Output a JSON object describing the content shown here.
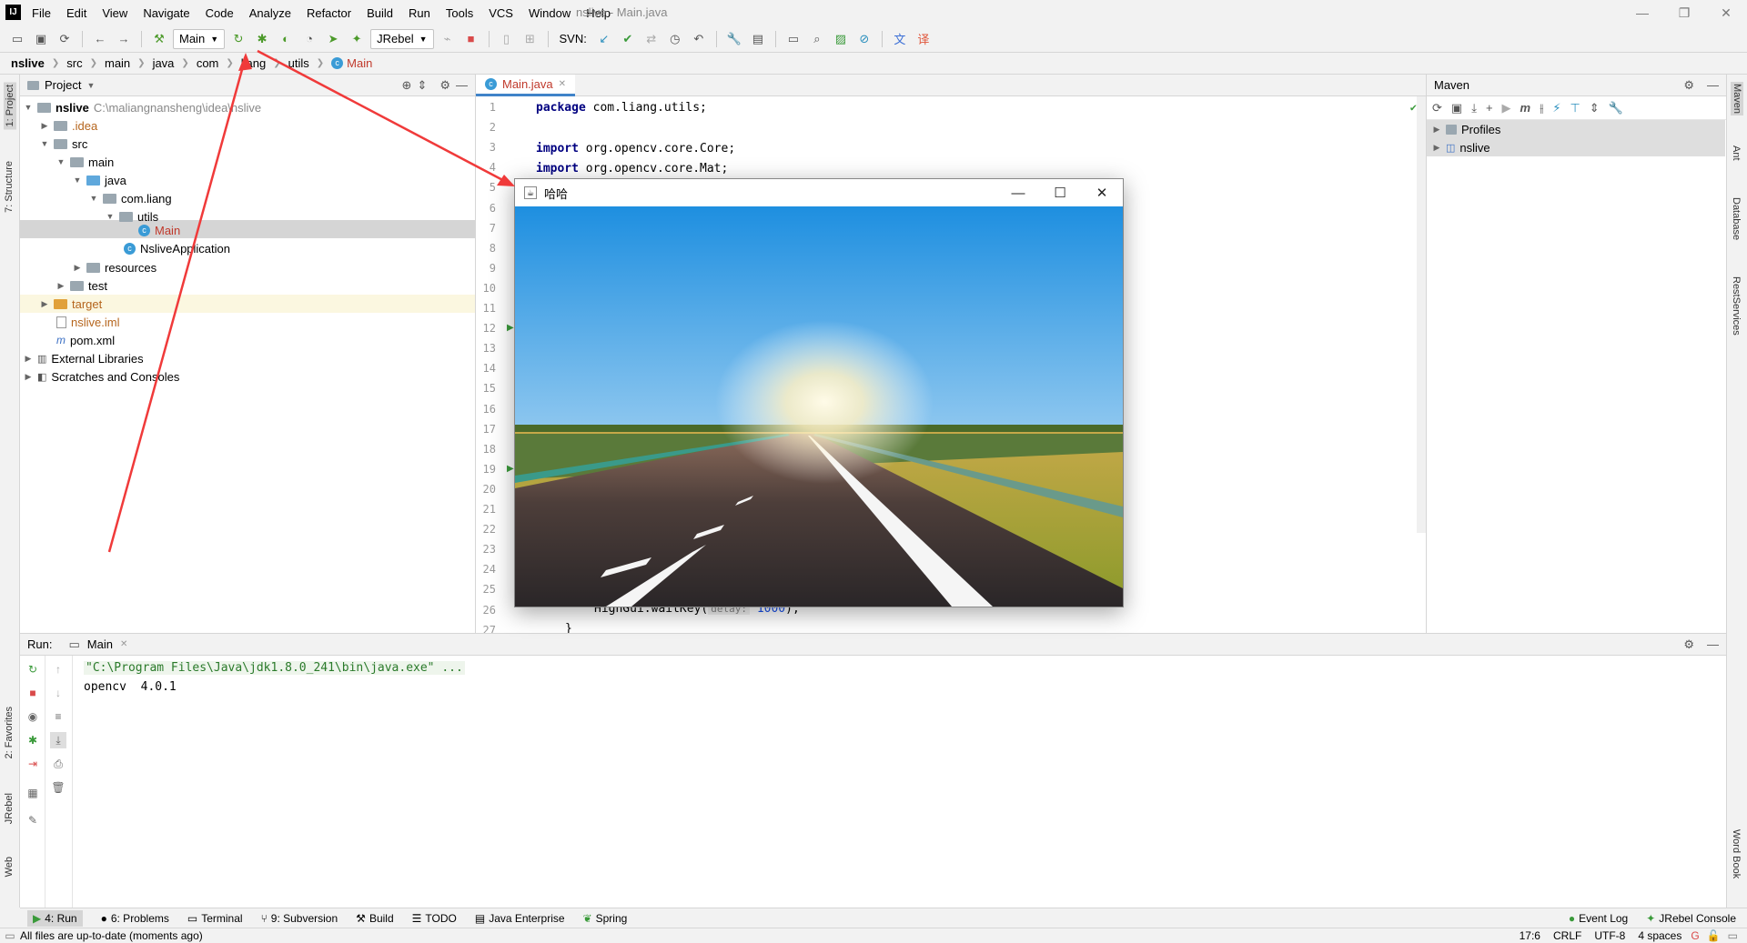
{
  "title_bar": {
    "app_icon": "intellij-logo",
    "menu": [
      "File",
      "Edit",
      "View",
      "Navigate",
      "Code",
      "Analyze",
      "Refactor",
      "Build",
      "Run",
      "Tools",
      "VCS",
      "Window",
      "Help"
    ],
    "window_title": "nslive - Main.java",
    "controls": [
      "minimize",
      "restore",
      "close"
    ]
  },
  "toolbar": {
    "run_config": "Main",
    "jrebel_config": "JRebel",
    "svn_label": "SVN:"
  },
  "breadcrumb": [
    "nslive",
    "src",
    "main",
    "java",
    "com",
    "liang",
    "utils",
    "Main"
  ],
  "left_stripe": {
    "project": "1: Project",
    "structure": "7: Structure",
    "favorites": "2: Favorites",
    "jrebel": "JRebel",
    "web": "Web"
  },
  "right_stripe": {
    "maven": "Maven",
    "ant": "Ant",
    "database": "Database",
    "rest": "RestServices",
    "wordbook": "Word Book"
  },
  "project_panel": {
    "title": "Project",
    "tree": [
      {
        "label": "nslive",
        "path": "C:\\maliangnansheng\\idea\\nslive"
      },
      {
        "label": ".idea"
      },
      {
        "label": "src"
      },
      {
        "label": "main"
      },
      {
        "label": "java"
      },
      {
        "label": "com.liang"
      },
      {
        "label": "utils"
      },
      {
        "label": "Main"
      },
      {
        "label": "NsliveApplication"
      },
      {
        "label": "resources"
      },
      {
        "label": "test"
      },
      {
        "label": "target"
      },
      {
        "label": "nslive.iml"
      },
      {
        "label": "pom.xml"
      },
      {
        "label": "External Libraries"
      },
      {
        "label": "Scratches and Consoles"
      }
    ]
  },
  "editor": {
    "tab": "Main.java",
    "line_numbers": [
      "1",
      "2",
      "3",
      "4",
      "5",
      "6",
      "7",
      "8",
      "9",
      "10",
      "11",
      "12",
      "13",
      "14",
      "15",
      "16",
      "17",
      "18",
      "19",
      "20",
      "21",
      "22",
      "23",
      "24",
      "25",
      "26",
      "27"
    ],
    "code": {
      "line1_kw": "package",
      "line1_rest": " com.liang.utils;",
      "line3_kw": "import",
      "line3_rest": " org.opencv.core.Core;",
      "line4_kw": "import",
      "line4_rest": " org.opencv.core.Mat;",
      "line26_call": "HighGui.waitKey(",
      "line26_hint": "delay:",
      "line26_value": "1000",
      "line26_end": ");",
      "line27": "}"
    }
  },
  "maven_panel": {
    "title": "Maven",
    "items": [
      "Profiles",
      "nslive"
    ]
  },
  "run_panel": {
    "label": "Run:",
    "tab": "Main",
    "console": [
      "\"C:\\Program Files\\Java\\jdk1.8.0_241\\bin\\java.exe\" ...",
      "opencv  4.0.1"
    ]
  },
  "bottom_tools": [
    "4: Run",
    "6: Problems",
    "Terminal",
    "9: Subversion",
    "Build",
    "TODO",
    "Java Enterprise",
    "Spring",
    "Event Log",
    "JRebel Console"
  ],
  "status_bar": {
    "message": "All files are up-to-date (moments ago)",
    "position": "17:6",
    "line_sep": "CRLF",
    "encoding": "UTF-8",
    "indent": "4 spaces"
  },
  "popup": {
    "title": "哈哈",
    "controls": [
      "minimize",
      "maximize",
      "close"
    ]
  }
}
